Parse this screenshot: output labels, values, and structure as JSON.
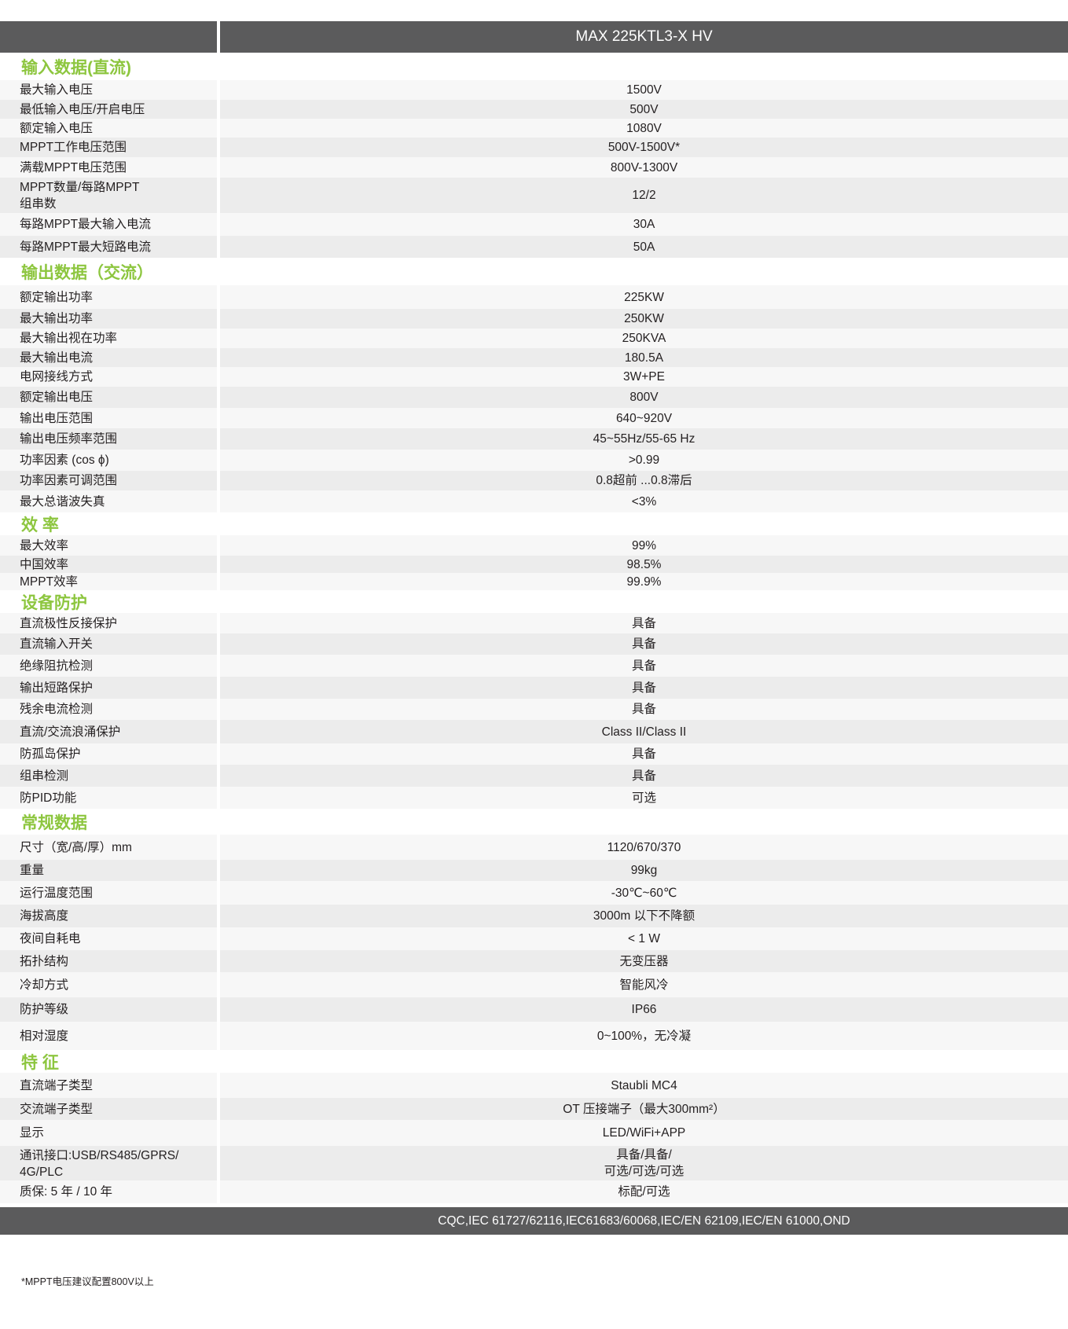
{
  "header": {
    "model": "MAX 225KTL3-X HV"
  },
  "sections": [
    {
      "title": "输入数据(直流)",
      "rows": [
        {
          "label": "最大输入电压",
          "value": "1500V",
          "h": 25
        },
        {
          "label": "最低输入电压/开启电压",
          "value": "500V",
          "h": 24
        },
        {
          "label": "额定输入电压",
          "value": "1080V",
          "h": 24
        },
        {
          "label": "MPPT工作电压范围",
          "value": "500V-1500V*",
          "h": 25
        },
        {
          "label": "满载MPPT电压范围",
          "value": "800V-1300V",
          "h": 26
        },
        {
          "label": "MPPT数量/每路MPPT\n组串数",
          "value": "12/2",
          "h": 45
        },
        {
          "label": "每路MPPT最大输入电流",
          "value": "30A",
          "h": 29
        },
        {
          "label": "每路MPPT最大短路电流",
          "value": "50A",
          "h": 28
        }
      ]
    },
    {
      "title": "输出数据（交流）",
      "rows": [
        {
          "label": "额定输出功率",
          "value": "225KW",
          "h": 30
        },
        {
          "label": "最大输出功率",
          "value": "250KW",
          "h": 25
        },
        {
          "label": "最大输出视在功率",
          "value": "250KVA",
          "h": 25
        },
        {
          "label": "最大输出电流",
          "value": "180.5A",
          "h": 24
        },
        {
          "label": "电网接线方式",
          "value": "3W+PE",
          "h": 25
        },
        {
          "label": "额定输出电压",
          "value": "800V",
          "h": 27
        },
        {
          "label": "输出电压范围",
          "value": "640~920V",
          "h": 26
        },
        {
          "label": "输出电压频率范围",
          "value": "45~55Hz/55-65 Hz",
          "h": 27
        },
        {
          "label": "功率因素 (cos ϕ)",
          "value": ">0.99",
          "h": 27
        },
        {
          "label": "功率因素可调范围",
          "value": "0.8超前 ...0.8滞后",
          "h": 25
        },
        {
          "label": "最大总谐波失真",
          "value": "<3%",
          "h": 28
        }
      ]
    },
    {
      "title": "效 率",
      "rows": [
        {
          "label": "最大效率",
          "value": "99%",
          "h": 26
        },
        {
          "label": "中国效率",
          "value": "98.5%",
          "h": 22
        },
        {
          "label": "MPPT效率",
          "value": "99.9%",
          "h": 22
        }
      ]
    },
    {
      "title": "设备防护",
      "rows": [
        {
          "label": "直流极性反接保护",
          "value": "具备",
          "h": 26
        },
        {
          "label": "直流输入开关",
          "value": "具备",
          "h": 27
        },
        {
          "label": "绝缘阻抗检测",
          "value": "具备",
          "h": 28
        },
        {
          "label": "输出短路保护",
          "value": "具备",
          "h": 28
        },
        {
          "label": "残余电流检测",
          "value": "具备",
          "h": 27
        },
        {
          "label": "直流/交流浪涌保护",
          "value": "Class II/Class II",
          "h": 30
        },
        {
          "label": "防孤岛保护",
          "value": "具备",
          "h": 27
        },
        {
          "label": "组串检测",
          "value": "具备",
          "h": 28
        },
        {
          "label": "防PID功能",
          "value": "可选",
          "h": 28
        }
      ]
    },
    {
      "title": "常规数据",
      "rows": [
        {
          "label": "尺寸（宽/高/厚）mm",
          "value": "1120/670/370",
          "h": 32
        },
        {
          "label": "重量",
          "value": "99kg",
          "h": 27
        },
        {
          "label": "运行温度范围",
          "value": "-30℃~60℃",
          "h": 30
        },
        {
          "label": "海拔高度",
          "value": "3000m 以下不降额",
          "h": 29
        },
        {
          "label": "夜间自耗电",
          "value": "< 1 W",
          "h": 29
        },
        {
          "label": "拓扑结构",
          "value": "无变压器",
          "h": 28
        },
        {
          "label": "冷却方式",
          "value": "智能风冷",
          "h": 32
        },
        {
          "label": "防护等级",
          "value": "IP66",
          "h": 31
        },
        {
          "label": "相对湿度",
          "value": "0~100%，无冷凝",
          "h": 36
        }
      ]
    },
    {
      "title": "特 征",
      "rows": [
        {
          "label": "直流端子类型",
          "value": "Staubli MC4",
          "h": 32
        },
        {
          "label": "交流端子类型",
          "value": "OT 压接端子（最大300mm²）",
          "h": 28
        },
        {
          "label": "显示",
          "value": "LED/WiFi+APP",
          "h": 33
        },
        {
          "label": "通讯接口:USB/RS485/GPRS/\n4G/PLC",
          "value": "具备/具备/\n可选/可选/可选",
          "h": 44
        },
        {
          "label": "质保: 5 年 / 10 年",
          "value": "标配/可选",
          "h": 29
        }
      ]
    }
  ],
  "footer": {
    "certifications": "CQC,IEC 61727/62116,IEC61683/60068,IEC/EN 62109,IEC/EN 61000,OND"
  },
  "note": "*MPPT电压建议配置800V以上",
  "colors": {
    "accent": "#8dc63f",
    "header_bg": "#5b5b5c",
    "row_light": "#f7f7f7",
    "row_dark": "#ececec"
  }
}
